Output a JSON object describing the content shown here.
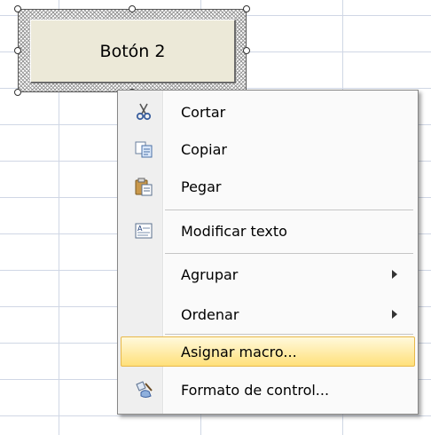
{
  "form_button": {
    "label": "Botón 2"
  },
  "context_menu": {
    "items": [
      {
        "label": "Cortar",
        "icon": "scissors-icon",
        "submenu": false
      },
      {
        "label": "Copiar",
        "icon": "copy-icon",
        "submenu": false
      },
      {
        "label": "Pegar",
        "icon": "paste-icon",
        "submenu": false
      },
      {
        "label": "Modificar texto",
        "icon": "edit-text-icon",
        "submenu": false
      },
      {
        "label": "Agrupar",
        "icon": "",
        "submenu": true
      },
      {
        "label": "Ordenar",
        "icon": "",
        "submenu": true
      },
      {
        "label": "Asignar macro...",
        "icon": "",
        "submenu": false,
        "highlighted": true
      },
      {
        "label": "Formato de control...",
        "icon": "format-control-icon",
        "submenu": false
      }
    ]
  },
  "colors": {
    "highlight": "#ffe07a",
    "button_face": "#ece9d8",
    "grid_line": "#d0d7e5"
  }
}
